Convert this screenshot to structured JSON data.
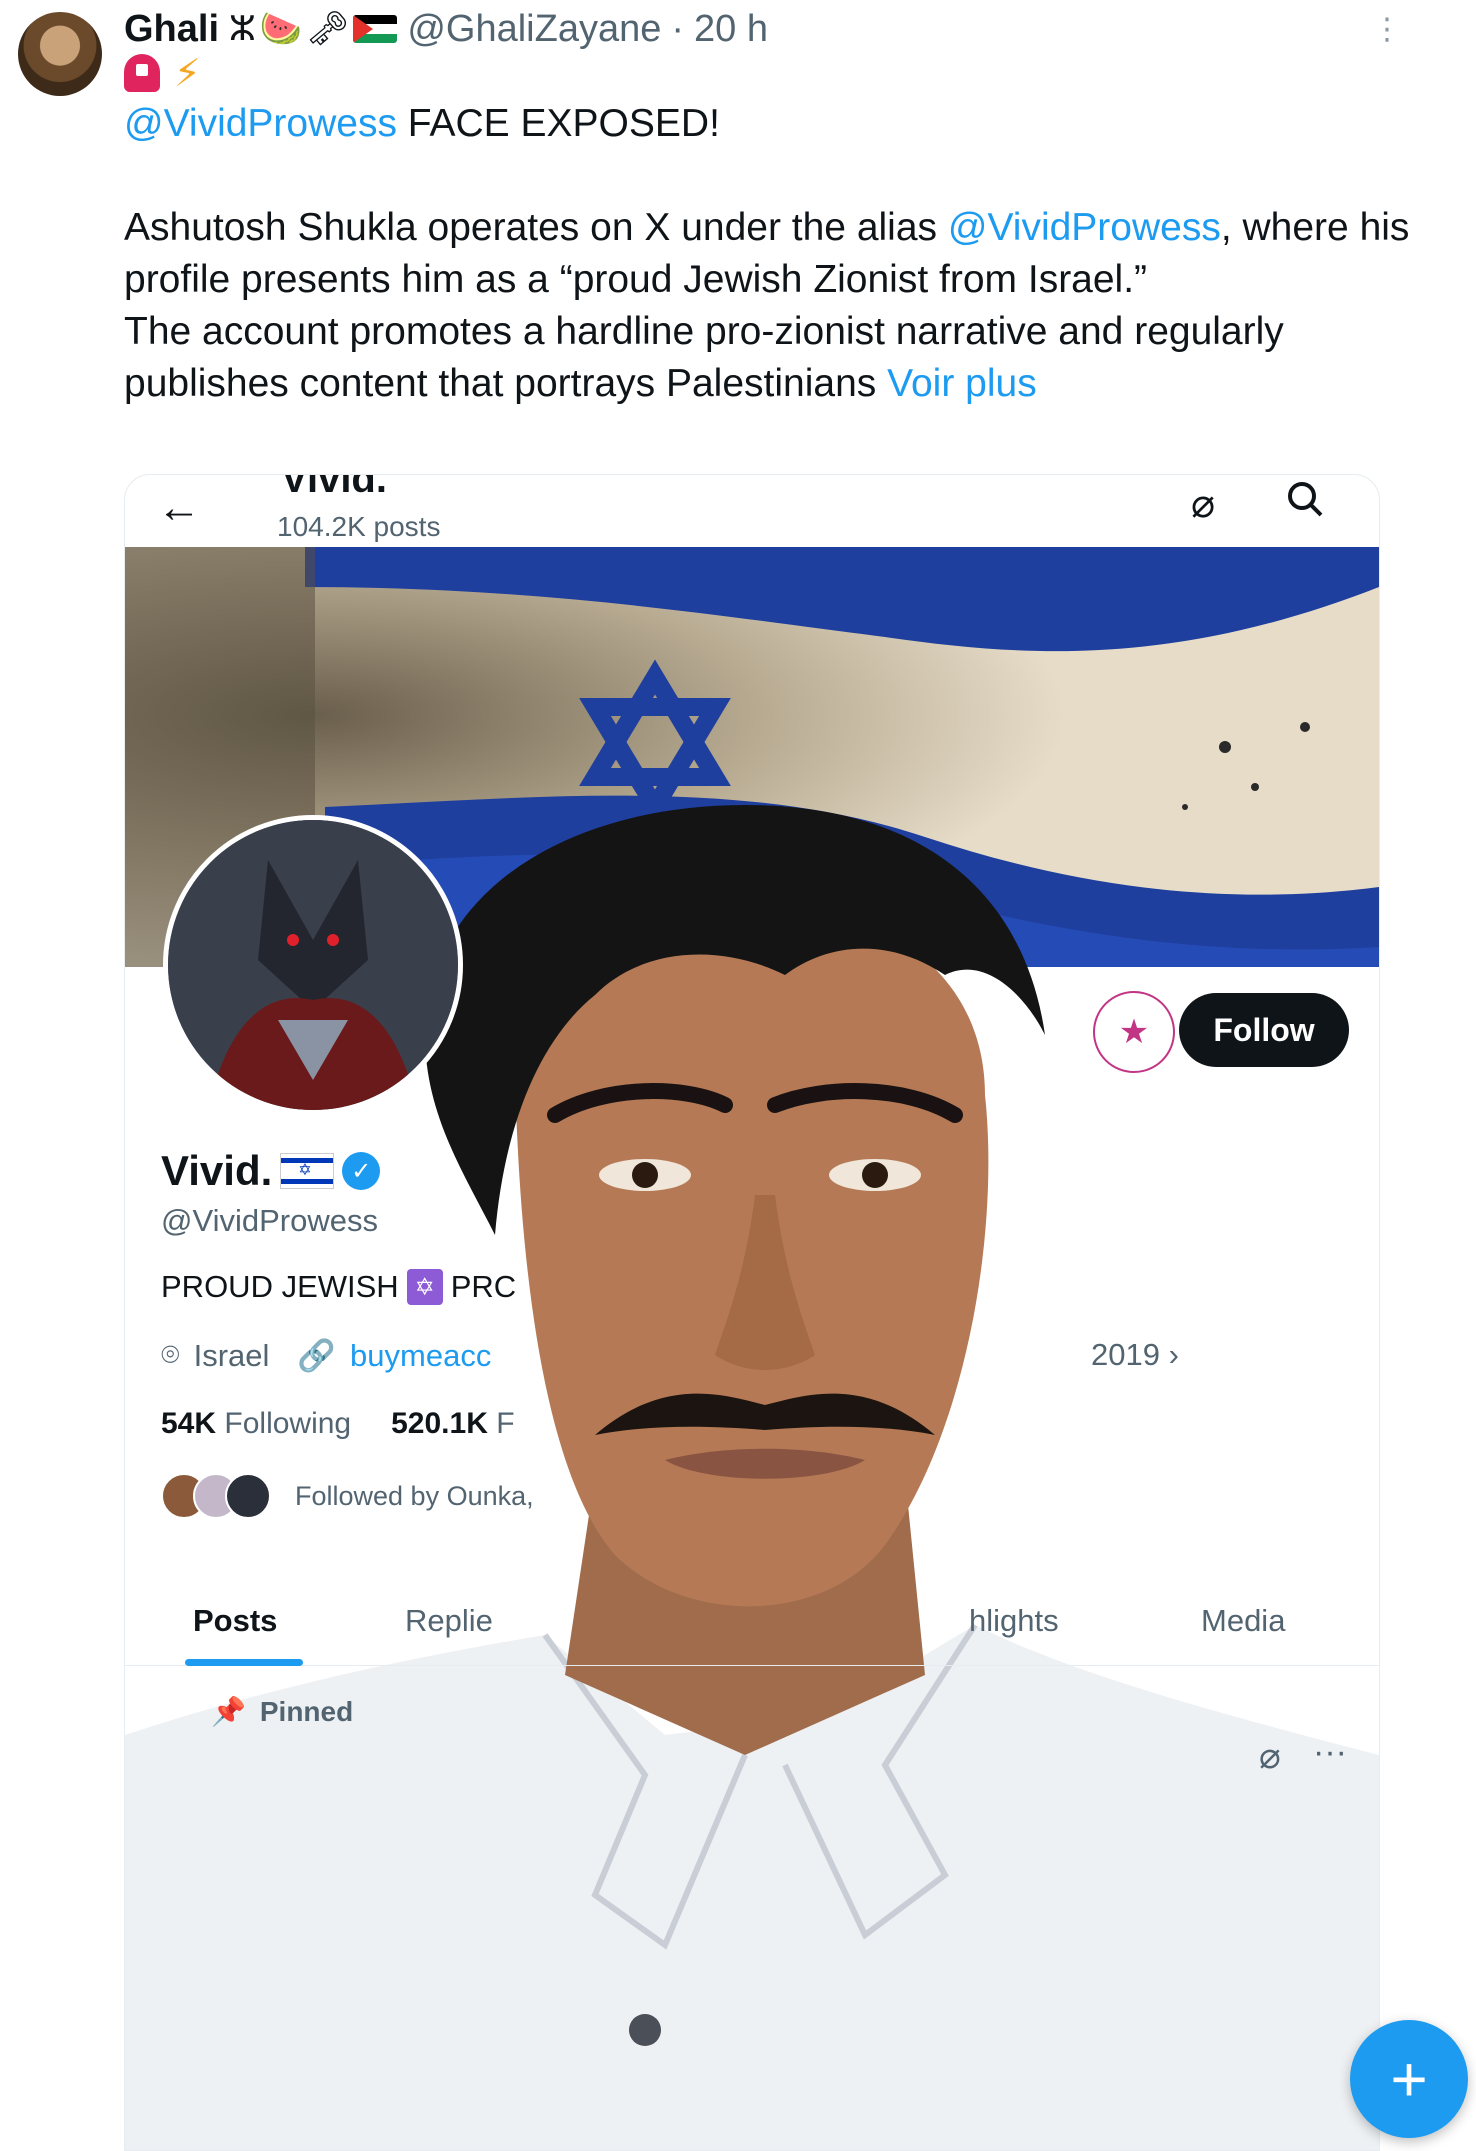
{
  "tweet": {
    "author_name": "Ghali",
    "author_handle": "@GhaliZayane",
    "separator": "·",
    "time": "20 h",
    "mention": "@VividProwess",
    "headline_rest": " FACE EXPOSED!",
    "para1_a": "Ashutosh Shukla operates on X under the alias ",
    "para1_mention": "@VividProwess",
    "para1_b": ", where his profile presents him as a “proud Jewish Zionist from Israel.”",
    "para2": "The account promotes a hardline pro-zionist narrative and regularly publishes content that portrays Palestinians ",
    "see_more": "Voir plus"
  },
  "embedded_profile": {
    "top_name": "Vivid.",
    "posts_count": "104.2K posts",
    "display_name": "Vivid.",
    "handle": "@VividProwess",
    "bio_a": "PROUD JEWISH",
    "bio_b": "PRC",
    "location": "Israel",
    "link": "buymeacc",
    "joined_fragment": "2019",
    "following_count": "54K",
    "following_label": "Following",
    "followers_count": "520.1K",
    "followers_fragment": "F",
    "followed_by": "Followed by Ounka, ",
    "follow_button": "Follow",
    "tabs": [
      "Posts",
      "Replie",
      "hlights",
      "Media"
    ],
    "pinned": "Pinned"
  },
  "colors": {
    "accent": "#1d9bf0",
    "text": "#0f1419",
    "muted": "#536471"
  },
  "icons": [
    "watermelon",
    "key",
    "palestine-flag",
    "siren",
    "lightning",
    "back-arrow",
    "grok-icon",
    "search-icon",
    "location-pin",
    "link-icon",
    "pin-icon",
    "plus-icon"
  ]
}
